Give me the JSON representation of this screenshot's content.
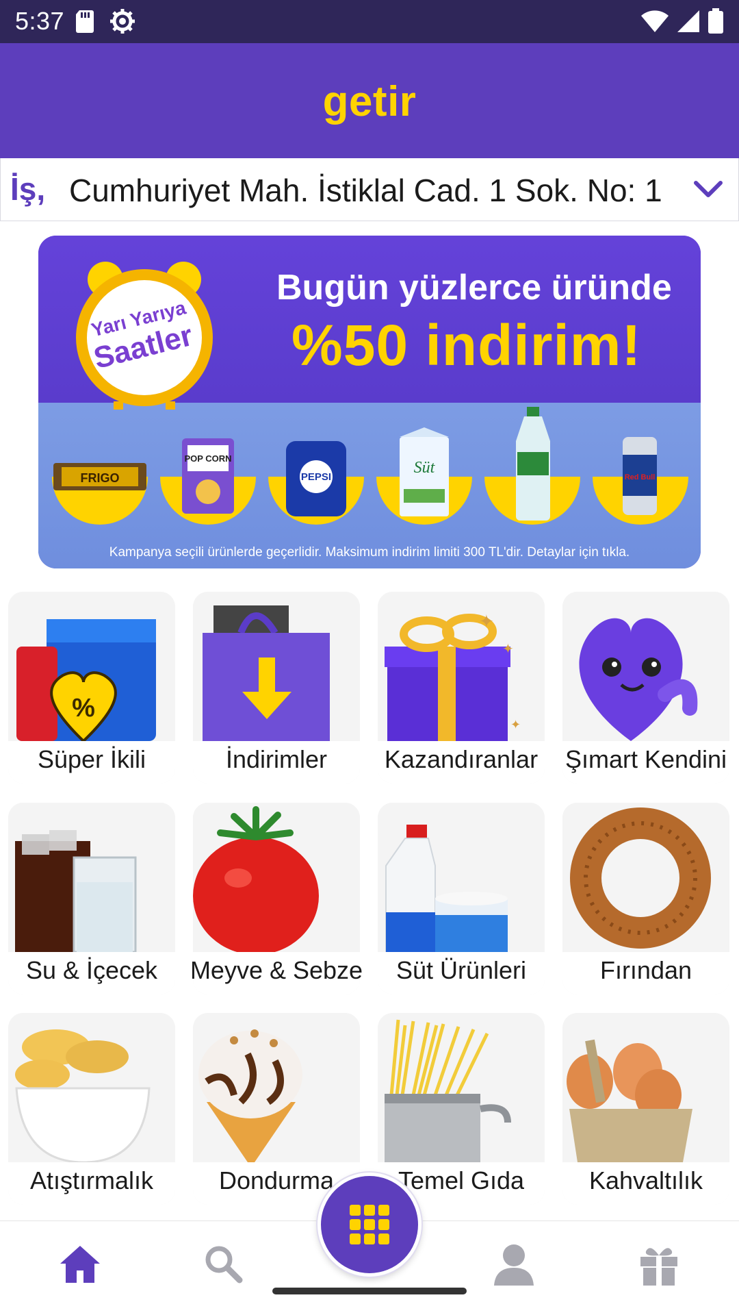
{
  "status_bar": {
    "time": "5:37",
    "left_icons": [
      "sd-card-icon",
      "settings-icon"
    ],
    "right_icons": [
      "wifi-icon",
      "signal-icon",
      "battery-icon"
    ]
  },
  "header": {
    "logo": "getir",
    "brand_color": "#5d3ebc",
    "accent_color": "#ffd300"
  },
  "address": {
    "type": "İş,",
    "text": "Cumhuriyet Mah. İstiklal Cad. 1 Sok. No: 1"
  },
  "banner": {
    "clock_line1": "Yarı Yarıya",
    "clock_line2": "Saatler",
    "title_line1": "Bugün yüzlerce üründe",
    "title_line2": "%50 indirim!",
    "footer": "Kampanya seçili ürünlerde geçerlidir. Maksimum indirim limiti 300 TL'dir. Detaylar için tıkla.",
    "products": [
      {
        "name": "chocolate-bar",
        "text": "FRIGO"
      },
      {
        "name": "popcorn-pack",
        "text": "POP CORN"
      },
      {
        "name": "pepsi-pack",
        "text": "PEPSI"
      },
      {
        "name": "milk-carton",
        "text": "Süt"
      },
      {
        "name": "water-bottle",
        "text": ""
      },
      {
        "name": "energy-can",
        "text": "Red Bull"
      }
    ]
  },
  "categories": [
    {
      "label": "Süper İkili",
      "icon": "super-pair-icon"
    },
    {
      "label": "İndirimler",
      "icon": "discount-bag-icon"
    },
    {
      "label": "Kazandıranlar",
      "icon": "gift-box-icon"
    },
    {
      "label": "Şımart Kendini",
      "icon": "heart-character-icon"
    },
    {
      "label": "Su & İçecek",
      "icon": "drinks-icon"
    },
    {
      "label": "Meyve & Sebze",
      "icon": "tomato-icon"
    },
    {
      "label": "Süt Ürünleri",
      "icon": "milk-icon"
    },
    {
      "label": "Fırından",
      "icon": "simit-icon"
    },
    {
      "label": "Atıştırmalık",
      "icon": "chips-icon"
    },
    {
      "label": "Dondurma",
      "icon": "ice-cream-icon"
    },
    {
      "label": "Temel Gıda",
      "icon": "pasta-icon"
    },
    {
      "label": "Kahvaltılık",
      "icon": "eggs-icon"
    }
  ],
  "bottom_nav": {
    "items": [
      "home-icon",
      "search-icon",
      "categories-grid-icon",
      "profile-icon",
      "gift-icon"
    ],
    "active": "home-icon"
  }
}
